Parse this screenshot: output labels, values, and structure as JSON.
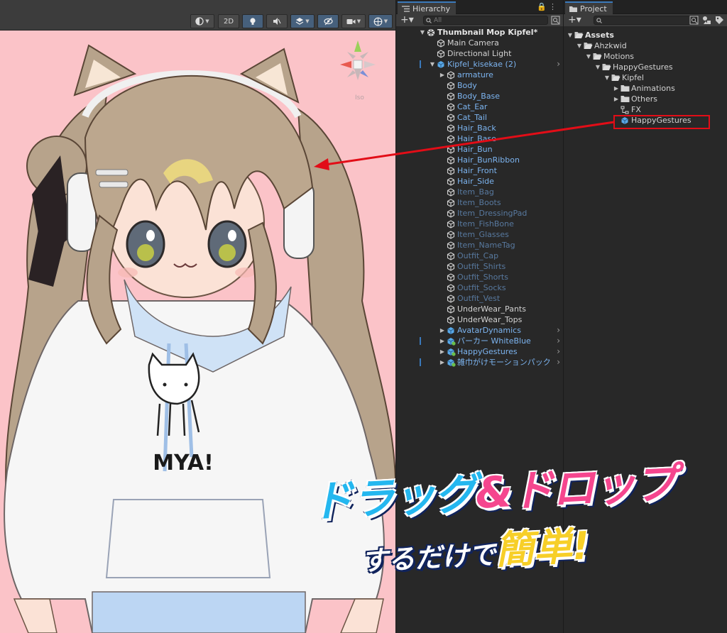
{
  "scene": {
    "toolbar": {
      "mode_2d": "2D"
    },
    "hoodie_text": "MYA!"
  },
  "hierarchy": {
    "tab_label": "Hierarchy",
    "search_placeholder": "All",
    "rows": [
      {
        "label": "Thumbnail Mop Kipfel*",
        "depth": 0,
        "arrow": "▼",
        "icon": "unity-scene-icon",
        "style": "bold"
      },
      {
        "label": "Main Camera",
        "depth": 1,
        "arrow": "",
        "icon": "cube-outline-icon",
        "style": "normal"
      },
      {
        "label": "Directional Light",
        "depth": 1,
        "arrow": "",
        "icon": "cube-outline-icon",
        "style": "normal"
      },
      {
        "label": "Kipfel_kisekae (2)",
        "depth": 1,
        "arrow": "▼",
        "icon": "prefab-cube-icon",
        "style": "blue",
        "more": true,
        "mark": true
      },
      {
        "label": "armature",
        "depth": 2,
        "arrow": "▶",
        "icon": "cube-outline-icon",
        "style": "blue"
      },
      {
        "label": "Body",
        "depth": 2,
        "arrow": "",
        "icon": "cube-outline-icon",
        "style": "blue"
      },
      {
        "label": "Body_Base",
        "depth": 2,
        "arrow": "",
        "icon": "cube-outline-icon",
        "style": "blue"
      },
      {
        "label": "Cat_Ear",
        "depth": 2,
        "arrow": "",
        "icon": "cube-outline-icon",
        "style": "blue"
      },
      {
        "label": "Cat_Tail",
        "depth": 2,
        "arrow": "",
        "icon": "cube-outline-icon",
        "style": "blue"
      },
      {
        "label": "Hair_Back",
        "depth": 2,
        "arrow": "",
        "icon": "cube-outline-icon",
        "style": "blue"
      },
      {
        "label": "Hair_Base",
        "depth": 2,
        "arrow": "",
        "icon": "cube-outline-icon",
        "style": "blue"
      },
      {
        "label": "Hair_Bun",
        "depth": 2,
        "arrow": "",
        "icon": "cube-outline-icon",
        "style": "blue"
      },
      {
        "label": "Hair_BunRibbon",
        "depth": 2,
        "arrow": "",
        "icon": "cube-outline-icon",
        "style": "blue"
      },
      {
        "label": "Hair_Front",
        "depth": 2,
        "arrow": "",
        "icon": "cube-outline-icon",
        "style": "blue"
      },
      {
        "label": "Hair_Side",
        "depth": 2,
        "arrow": "",
        "icon": "cube-outline-icon",
        "style": "blue"
      },
      {
        "label": "Item_Bag",
        "depth": 2,
        "arrow": "",
        "icon": "cube-outline-icon",
        "style": "dim"
      },
      {
        "label": "Item_Boots",
        "depth": 2,
        "arrow": "",
        "icon": "cube-outline-icon",
        "style": "dim"
      },
      {
        "label": "Item_DressingPad",
        "depth": 2,
        "arrow": "",
        "icon": "cube-outline-icon",
        "style": "dim"
      },
      {
        "label": "Item_FishBone",
        "depth": 2,
        "arrow": "",
        "icon": "cube-outline-icon",
        "style": "dim"
      },
      {
        "label": "Item_Glasses",
        "depth": 2,
        "arrow": "",
        "icon": "cube-outline-icon",
        "style": "dim"
      },
      {
        "label": "Item_NameTag",
        "depth": 2,
        "arrow": "",
        "icon": "cube-outline-icon",
        "style": "dim"
      },
      {
        "label": "Outfit_Cap",
        "depth": 2,
        "arrow": "",
        "icon": "cube-outline-icon",
        "style": "dim"
      },
      {
        "label": "Outfit_Shirts",
        "depth": 2,
        "arrow": "",
        "icon": "cube-outline-icon",
        "style": "dim"
      },
      {
        "label": "Outfit_Shorts",
        "depth": 2,
        "arrow": "",
        "icon": "cube-outline-icon",
        "style": "dim"
      },
      {
        "label": "Outfit_Socks",
        "depth": 2,
        "arrow": "",
        "icon": "cube-outline-icon",
        "style": "dim"
      },
      {
        "label": "Outfit_Vest",
        "depth": 2,
        "arrow": "",
        "icon": "cube-outline-icon",
        "style": "dim"
      },
      {
        "label": "UnderWear_Pants",
        "depth": 2,
        "arrow": "",
        "icon": "cube-outline-icon",
        "style": "normal"
      },
      {
        "label": "UnderWear_Tops",
        "depth": 2,
        "arrow": "",
        "icon": "cube-outline-icon",
        "style": "normal"
      },
      {
        "label": "AvatarDynamics",
        "depth": 2,
        "arrow": "▶",
        "icon": "prefab-cube-icon",
        "style": "blue",
        "more": true
      },
      {
        "label": "パーカー WhiteBlue",
        "depth": 2,
        "arrow": "▶",
        "icon": "prefab-variant-icon",
        "style": "blue",
        "more": true,
        "mark": true
      },
      {
        "label": "HappyGestures",
        "depth": 2,
        "arrow": "▶",
        "icon": "prefab-variant-icon",
        "style": "blue",
        "more": true
      },
      {
        "label": "雑巾がけモーションパック",
        "depth": 2,
        "arrow": "▶",
        "icon": "prefab-variant-icon",
        "style": "blue",
        "more": true,
        "mark": true
      }
    ]
  },
  "project": {
    "tab_label": "Project",
    "rows": [
      {
        "label": "Assets",
        "depth": 0,
        "arrow": "▼",
        "icon": "folder-open-icon",
        "style": "bold"
      },
      {
        "label": "Ahzkwid",
        "depth": 1,
        "arrow": "▼",
        "icon": "folder-open-icon",
        "style": "normal"
      },
      {
        "label": "Motions",
        "depth": 2,
        "arrow": "▼",
        "icon": "folder-open-icon",
        "style": "normal"
      },
      {
        "label": "HappyGestures",
        "depth": 3,
        "arrow": "▼",
        "icon": "folder-open-icon",
        "style": "normal"
      },
      {
        "label": "Kipfel",
        "depth": 4,
        "arrow": "▼",
        "icon": "folder-open-icon",
        "style": "normal"
      },
      {
        "label": "Animations",
        "depth": 5,
        "arrow": "▶",
        "icon": "folder-icon",
        "style": "normal"
      },
      {
        "label": "Others",
        "depth": 5,
        "arrow": "▶",
        "icon": "folder-icon",
        "style": "normal"
      },
      {
        "label": "FX",
        "depth": 5,
        "arrow": "",
        "icon": "animator-controller-icon",
        "style": "normal"
      },
      {
        "label": "HappyGestures",
        "depth": 5,
        "arrow": "",
        "icon": "prefab-cube-icon",
        "style": "normal"
      }
    ]
  },
  "banner": {
    "line1_blue": "ドラッグ",
    "line1_amp": "&",
    "line1_pink": "ドロップ",
    "line2_small": "するだけで",
    "line2_big": "簡単!"
  },
  "colors": {
    "scene_bg": "#fbc3c8",
    "highlight_red": "#e20d17",
    "prefab_blue": "#7cb4f0",
    "panel_bg": "#282828"
  }
}
